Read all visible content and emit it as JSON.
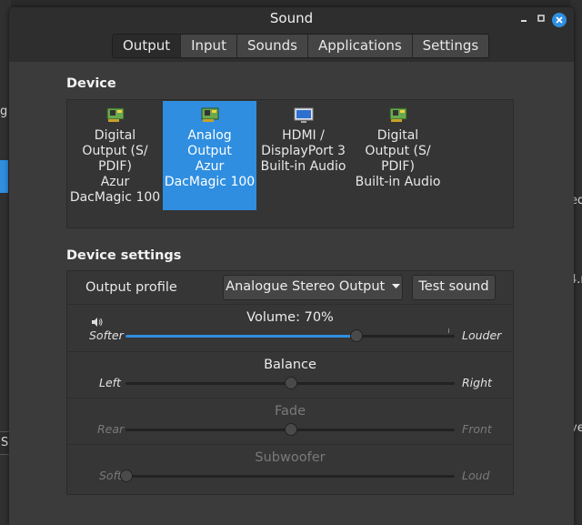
{
  "window": {
    "title": "Sound"
  },
  "tabs": [
    {
      "label": "Output",
      "active": true
    },
    {
      "label": "Input"
    },
    {
      "label": "Sounds"
    },
    {
      "label": "Applications"
    },
    {
      "label": "Settings"
    }
  ],
  "device_section": {
    "title": "Device",
    "devices": [
      {
        "label": "Digital\nOutput (S/\nPDIF)\nAzur\nDacMagic 100",
        "icon": "sound-card-icon",
        "selected": false
      },
      {
        "label": "Analog\nOutput\nAzur\nDacMagic 100",
        "icon": "sound-card-icon",
        "selected": true
      },
      {
        "label": "HDMI /\nDisplayPort 3\nBuilt-in Audio",
        "icon": "monitor-icon",
        "selected": false
      },
      {
        "label": "Digital\nOutput (S/\nPDIF)\nBuilt-in Audio",
        "icon": "sound-card-icon",
        "selected": false
      }
    ]
  },
  "settings_section": {
    "title": "Device settings",
    "output_profile_label": "Output profile",
    "output_profile_value": "Analogue Stereo Output",
    "test_sound_label": "Test sound",
    "volume": {
      "title": "Volume: 70%",
      "left": "Softer",
      "right": "Louder",
      "level_percent": 70
    },
    "balance": {
      "title": "Balance",
      "left": "Left",
      "right": "Right",
      "level_percent": 50
    },
    "fade": {
      "title": "Fade",
      "left": "Rear",
      "right": "Front",
      "level_percent": 50,
      "disabled": true
    },
    "subwoofer": {
      "title": "Subwoofer",
      "left": "Soft",
      "right": "Loud",
      "level_percent": 0,
      "disabled": true
    }
  },
  "background": {
    "left_edge_text_1": "g",
    "left_edge_text_2": "S",
    "right_edge_text_1": "ed",
    "right_edge_text_2": "4.n",
    "right_edge_text_3": "ve"
  },
  "colors": {
    "accent": "#2f8ee0",
    "window_bg": "#3b3b3b",
    "titlebar_bg": "#2e2e2e"
  }
}
